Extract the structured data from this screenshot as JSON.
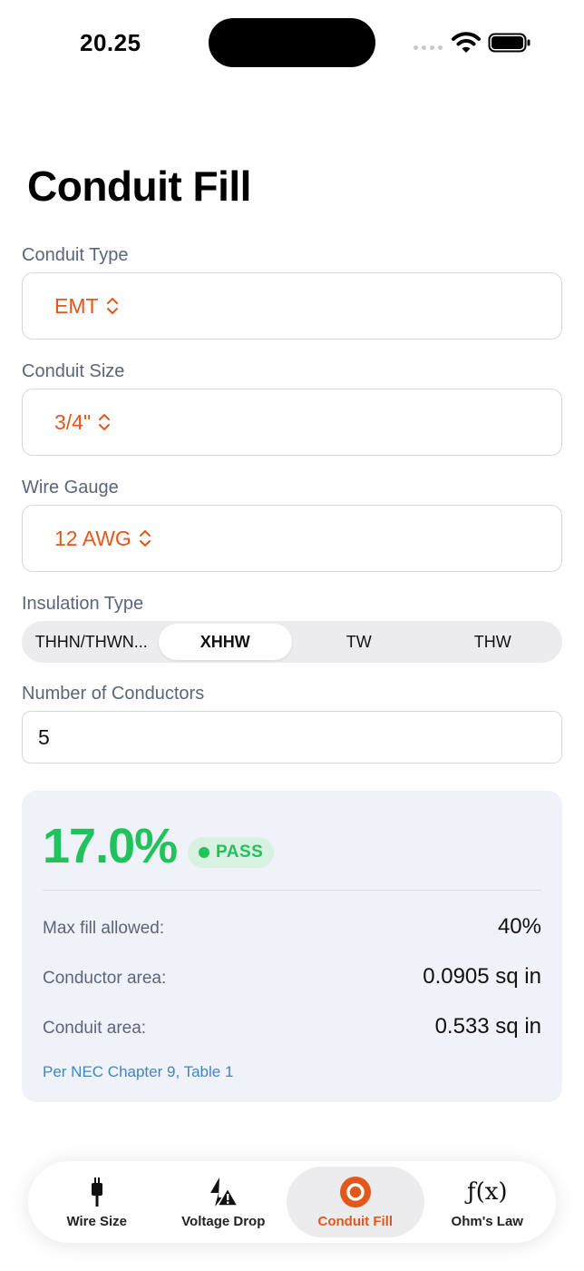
{
  "status_bar": {
    "time": "20.25"
  },
  "page": {
    "title": "Conduit Fill"
  },
  "form": {
    "conduit_type": {
      "label": "Conduit Type",
      "value": "EMT"
    },
    "conduit_size": {
      "label": "Conduit Size",
      "value": "3/4\""
    },
    "wire_gauge": {
      "label": "Wire Gauge",
      "value": "12 AWG"
    },
    "insulation_type": {
      "label": "Insulation Type",
      "options": [
        "THHN/THWN...",
        "XHHW",
        "TW",
        "THW"
      ],
      "selected": "XHHW"
    },
    "conductors": {
      "label": "Number of Conductors",
      "value": "5"
    }
  },
  "result": {
    "fill_percent": "17.0%",
    "status": "PASS",
    "rows": [
      {
        "label": "Max fill allowed:",
        "value": "40%"
      },
      {
        "label": "Conductor area:",
        "value": "0.0905 sq in"
      },
      {
        "label": "Conduit area:",
        "value": "0.533 sq in"
      }
    ],
    "note": "Per NEC Chapter 9, Table 1"
  },
  "tabs": [
    {
      "label": "Wire Size",
      "icon": "plug-icon"
    },
    {
      "label": "Voltage Drop",
      "icon": "bolt-warning-icon"
    },
    {
      "label": "Conduit Fill",
      "icon": "conduit-circle-icon",
      "active": true
    },
    {
      "label": "Ohm's Law",
      "icon": "function-icon"
    }
  ],
  "colors": {
    "accent": "#e2571a",
    "pass": "#21c25b",
    "label": "#5c6578",
    "link": "#3f86c8",
    "card": "#eff2f8"
  }
}
